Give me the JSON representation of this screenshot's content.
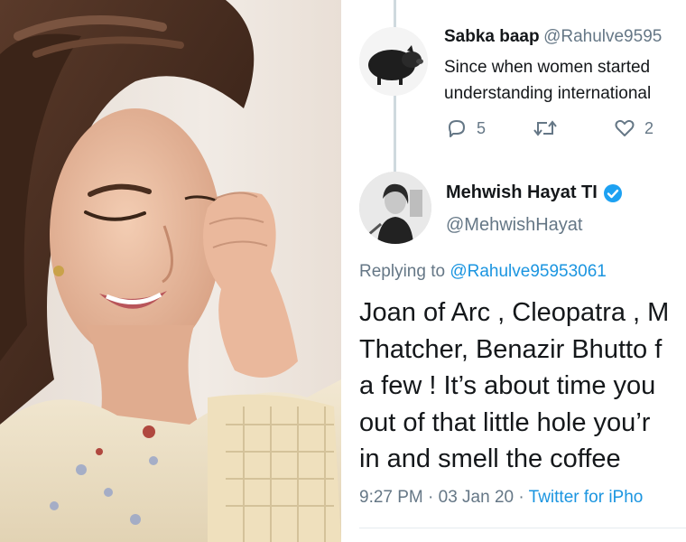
{
  "reply_tweet": {
    "name": "Sabka baap",
    "handle": "@Rahulve9595",
    "text_lines": [
      "Since when women started",
      "understanding international"
    ],
    "reply_count": "5",
    "retweet_count": "",
    "like_count": "2"
  },
  "main_tweet": {
    "name": "Mehwish Hayat TI",
    "handle": "@MehwishHayat",
    "replying_prefix": "Replying to ",
    "replying_to": "@Rahulve95953061",
    "text_lines": [
      "Joan of Arc , Cleopatra , M",
      "Thatcher, Benazir Bhutto f",
      "a few ! It’s about time you",
      "out of that little hole you’r",
      "in and smell the coffee"
    ],
    "time": "9:27 PM · 03 Jan 20 · ",
    "source": "Twitter for iPho"
  },
  "colors": {
    "link": "#1b95e0",
    "secondary_text": "#657786",
    "thread_line": "#cfd9de"
  },
  "icons": [
    "reply-icon",
    "retweet-icon",
    "like-icon",
    "verified-badge-icon"
  ]
}
